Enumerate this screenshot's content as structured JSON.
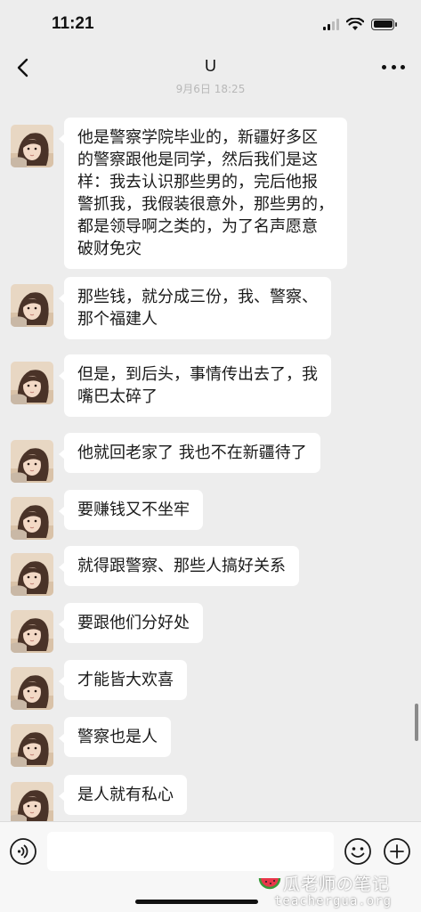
{
  "status_bar": {
    "time": "11:21"
  },
  "nav": {
    "title": "U"
  },
  "timestamp": "9月6日 18:25",
  "messages": [
    {
      "text": "他是警察学院毕业的，新疆好多区\n的警察跟他是同学，然后我们是这\n样：我去认识那些男的，完后他报\n警抓我，我假装很意外，那些男的，\n都是领导啊之类的，为了名声愿意\n破财免灾"
    },
    {
      "text": "那些钱，就分成三份，我、警察、\n那个福建人"
    },
    {
      "text": "但是，到后头，事情传出去了，我\n嘴巴太碎了"
    },
    {
      "text": "他就回老家了 我也不在新疆待了"
    },
    {
      "text": "要赚钱又不坐牢"
    },
    {
      "text": "就得跟警察、那些人搞好关系"
    },
    {
      "text": "要跟他们分好处"
    },
    {
      "text": "才能皆大欢喜"
    },
    {
      "text": "警察也是人"
    },
    {
      "text": "是人就有私心"
    }
  ],
  "watermark": {
    "main": "瓜老师の笔记",
    "sub": "teachergua.org"
  },
  "icons": {
    "back": "chevron-left-icon",
    "more": "more-dots-icon",
    "voice": "voice-icon",
    "emoji": "emoji-icon",
    "plus": "plus-icon",
    "avatar": "avatar"
  },
  "colors": {
    "background": "#ededed",
    "bubble": "#ffffff",
    "text": "#1a1a1a"
  }
}
